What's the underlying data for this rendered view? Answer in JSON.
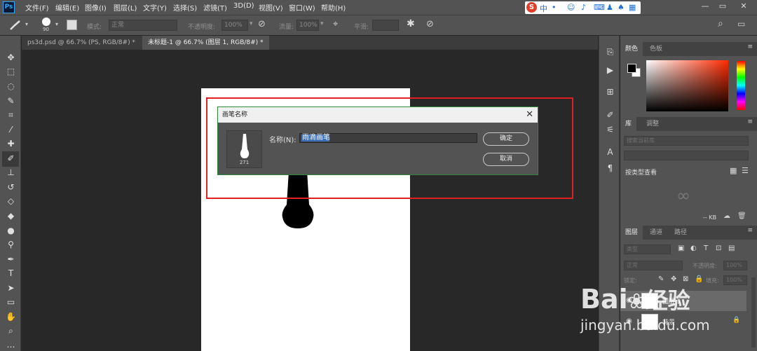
{
  "app": {
    "logo": "Ps"
  },
  "menu": [
    "文件(F)",
    "编辑(E)",
    "图像(I)",
    "图层(L)",
    "文字(Y)",
    "选择(S)",
    "滤镜(T)",
    "3D(D)",
    "视图(V)",
    "窗口(W)",
    "帮助(H)"
  ],
  "ime": {
    "logo": "S",
    "lang": "中"
  },
  "window_controls": {
    "minimize": "—",
    "restore": "▭",
    "close": "✕"
  },
  "options": {
    "brush_size": "90",
    "mode_label": "模式:",
    "mode_value": "正常",
    "opacity_label": "不透明度:",
    "opacity_value": "100%",
    "flow_label": "流量:",
    "flow_value": "100%",
    "smooth_label": "平滑:"
  },
  "tabs": [
    {
      "label": "ps3d.psd @ 66.7% (PS, RGB/8#) *"
    },
    {
      "label": "未标题-1 @ 66.7% (图层 1, RGB/8#) *"
    }
  ],
  "dialog": {
    "title": "画笔名称",
    "close": "✕",
    "brush_number": "271",
    "name_label": "名称(N):",
    "name_value": "雨滴画笔",
    "ok_label": "确定",
    "cancel_label": "取消"
  },
  "color_panel": {
    "tabs": [
      "颜色",
      "色板"
    ],
    "accent": "#ff2a00"
  },
  "library_panel": {
    "tabs": [
      "库",
      "调整"
    ],
    "search_placeholder": "搜索当前库",
    "view_label": "按类型查看",
    "size": "-- KB"
  },
  "layers_panel": {
    "tabs": [
      "图层",
      "通道",
      "路径"
    ],
    "filter_label": "类型",
    "blend_mode": "正常",
    "opacity_label": "不透明度:",
    "opacity_value": "100%",
    "lock_label": "锁定:",
    "fill_label": "填充:",
    "fill_value": "100%",
    "layers": [
      {
        "name": "图层 1"
      },
      {
        "name": "背景"
      }
    ]
  },
  "watermark": {
    "brand": "Bai",
    "brand2": "经验",
    "url": "jingyan.baidu.com"
  }
}
